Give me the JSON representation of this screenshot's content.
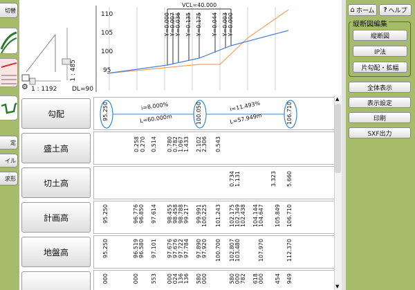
{
  "left_toolbar": {
    "top_label": "切替",
    "btn_1": "定",
    "btn_2": "イル",
    "btn_3": "求形"
  },
  "chart": {
    "y_ticks": [
      "110",
      "105",
      "100",
      "95"
    ],
    "vcl_label": "VCL=40.000",
    "point_labels": [
      "Y=0.000",
      "Y=0.007",
      "Y=0.036",
      "Y=0.135",
      "Y=0.175",
      "Y=0.044",
      "Y=0.003",
      "Y=0.000"
    ],
    "scale_vertical": "1 : 485",
    "scale_horizontal": "1 : 1192",
    "datum_label": "DL=90"
  },
  "rows": [
    {
      "label": "勾配",
      "values": [
        "95.250",
        "100.050",
        "106.710"
      ],
      "grades": [
        {
          "i": "i=8.000%",
          "L": "L=60.000m"
        },
        {
          "i": "i=11.493%",
          "L": "L=57.949m"
        }
      ]
    },
    {
      "label": "盛土高",
      "values": [
        "0.258",
        "0.270",
        "0.514",
        "0.780",
        "0.782",
        "1.067",
        "1.433",
        "2.102",
        "2.306",
        "0.543"
      ]
    },
    {
      "label": "切土高",
      "values": [
        "0.734",
        "1.131",
        "3.323",
        "5.660"
      ]
    },
    {
      "label": "計画高",
      "values": [
        "95.250",
        "96.776",
        "96.850",
        "97.614",
        "98.455",
        "98.458",
        "98.788",
        "99.217",
        "99.991",
        "100.225",
        "101.243",
        "102.175",
        "102.349",
        "102.438",
        "104.144",
        "104.647",
        "105.849",
        "106.710"
      ]
    },
    {
      "label": "地盤高",
      "values": [
        "95.250",
        "96.519",
        "96.580",
        "97.101",
        "97.676",
        "97.676",
        "97.722",
        "97.784",
        "97.890",
        "97.920",
        "100.700",
        "102.807",
        "103.480",
        "107.970",
        "112.370"
      ]
    },
    {
      "label": "",
      "values": [
        "000",
        "000",
        "553",
        "000",
        "024",
        "136",
        "136",
        "580",
        "000",
        "580",
        "000",
        "782",
        "618",
        "000",
        "454",
        "949"
      ]
    }
  ],
  "right_panel": {
    "home_label": "ホーム",
    "help_label": "ヘルプ",
    "group_title": "縦断図編集",
    "btn_profile": "縦断図",
    "btn_ip": "IP法",
    "btn_slope": "片勾配・拡幅",
    "btn_all": "全体表示",
    "btn_display": "表示設定",
    "btn_print": "印刷",
    "btn_sxf": "SXF出力"
  },
  "colors": {
    "panel_green": "#a6bc6a",
    "ground_line": "#f5a05a",
    "plan_line": "#4a7fd4",
    "ellipse": "#2e86de"
  }
}
